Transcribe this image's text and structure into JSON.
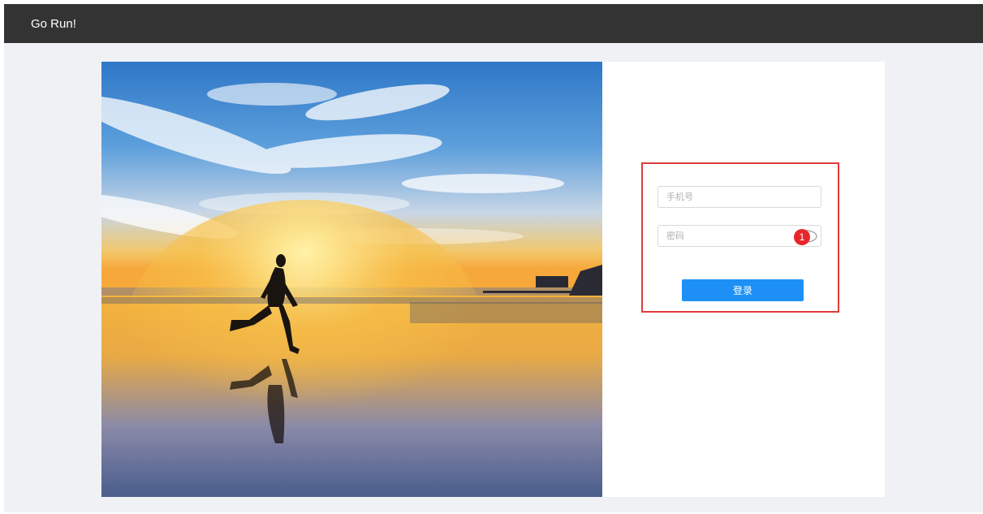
{
  "navbar": {
    "brand": "Go Run!"
  },
  "hero": {
    "image_subject": "runner-silhouette-at-sunset-beach"
  },
  "login_form": {
    "phone_placeholder": "手机号",
    "password_placeholder": "密码",
    "badge_number": "1",
    "login_label": "登录",
    "password_toggle_icon": "eye-icon"
  },
  "colors": {
    "navbar_bg": "#333333",
    "page_bg": "#f0f1f5",
    "accent": "#1e90f5",
    "highlight": "#e03b3b",
    "badge": "#e8262a"
  }
}
